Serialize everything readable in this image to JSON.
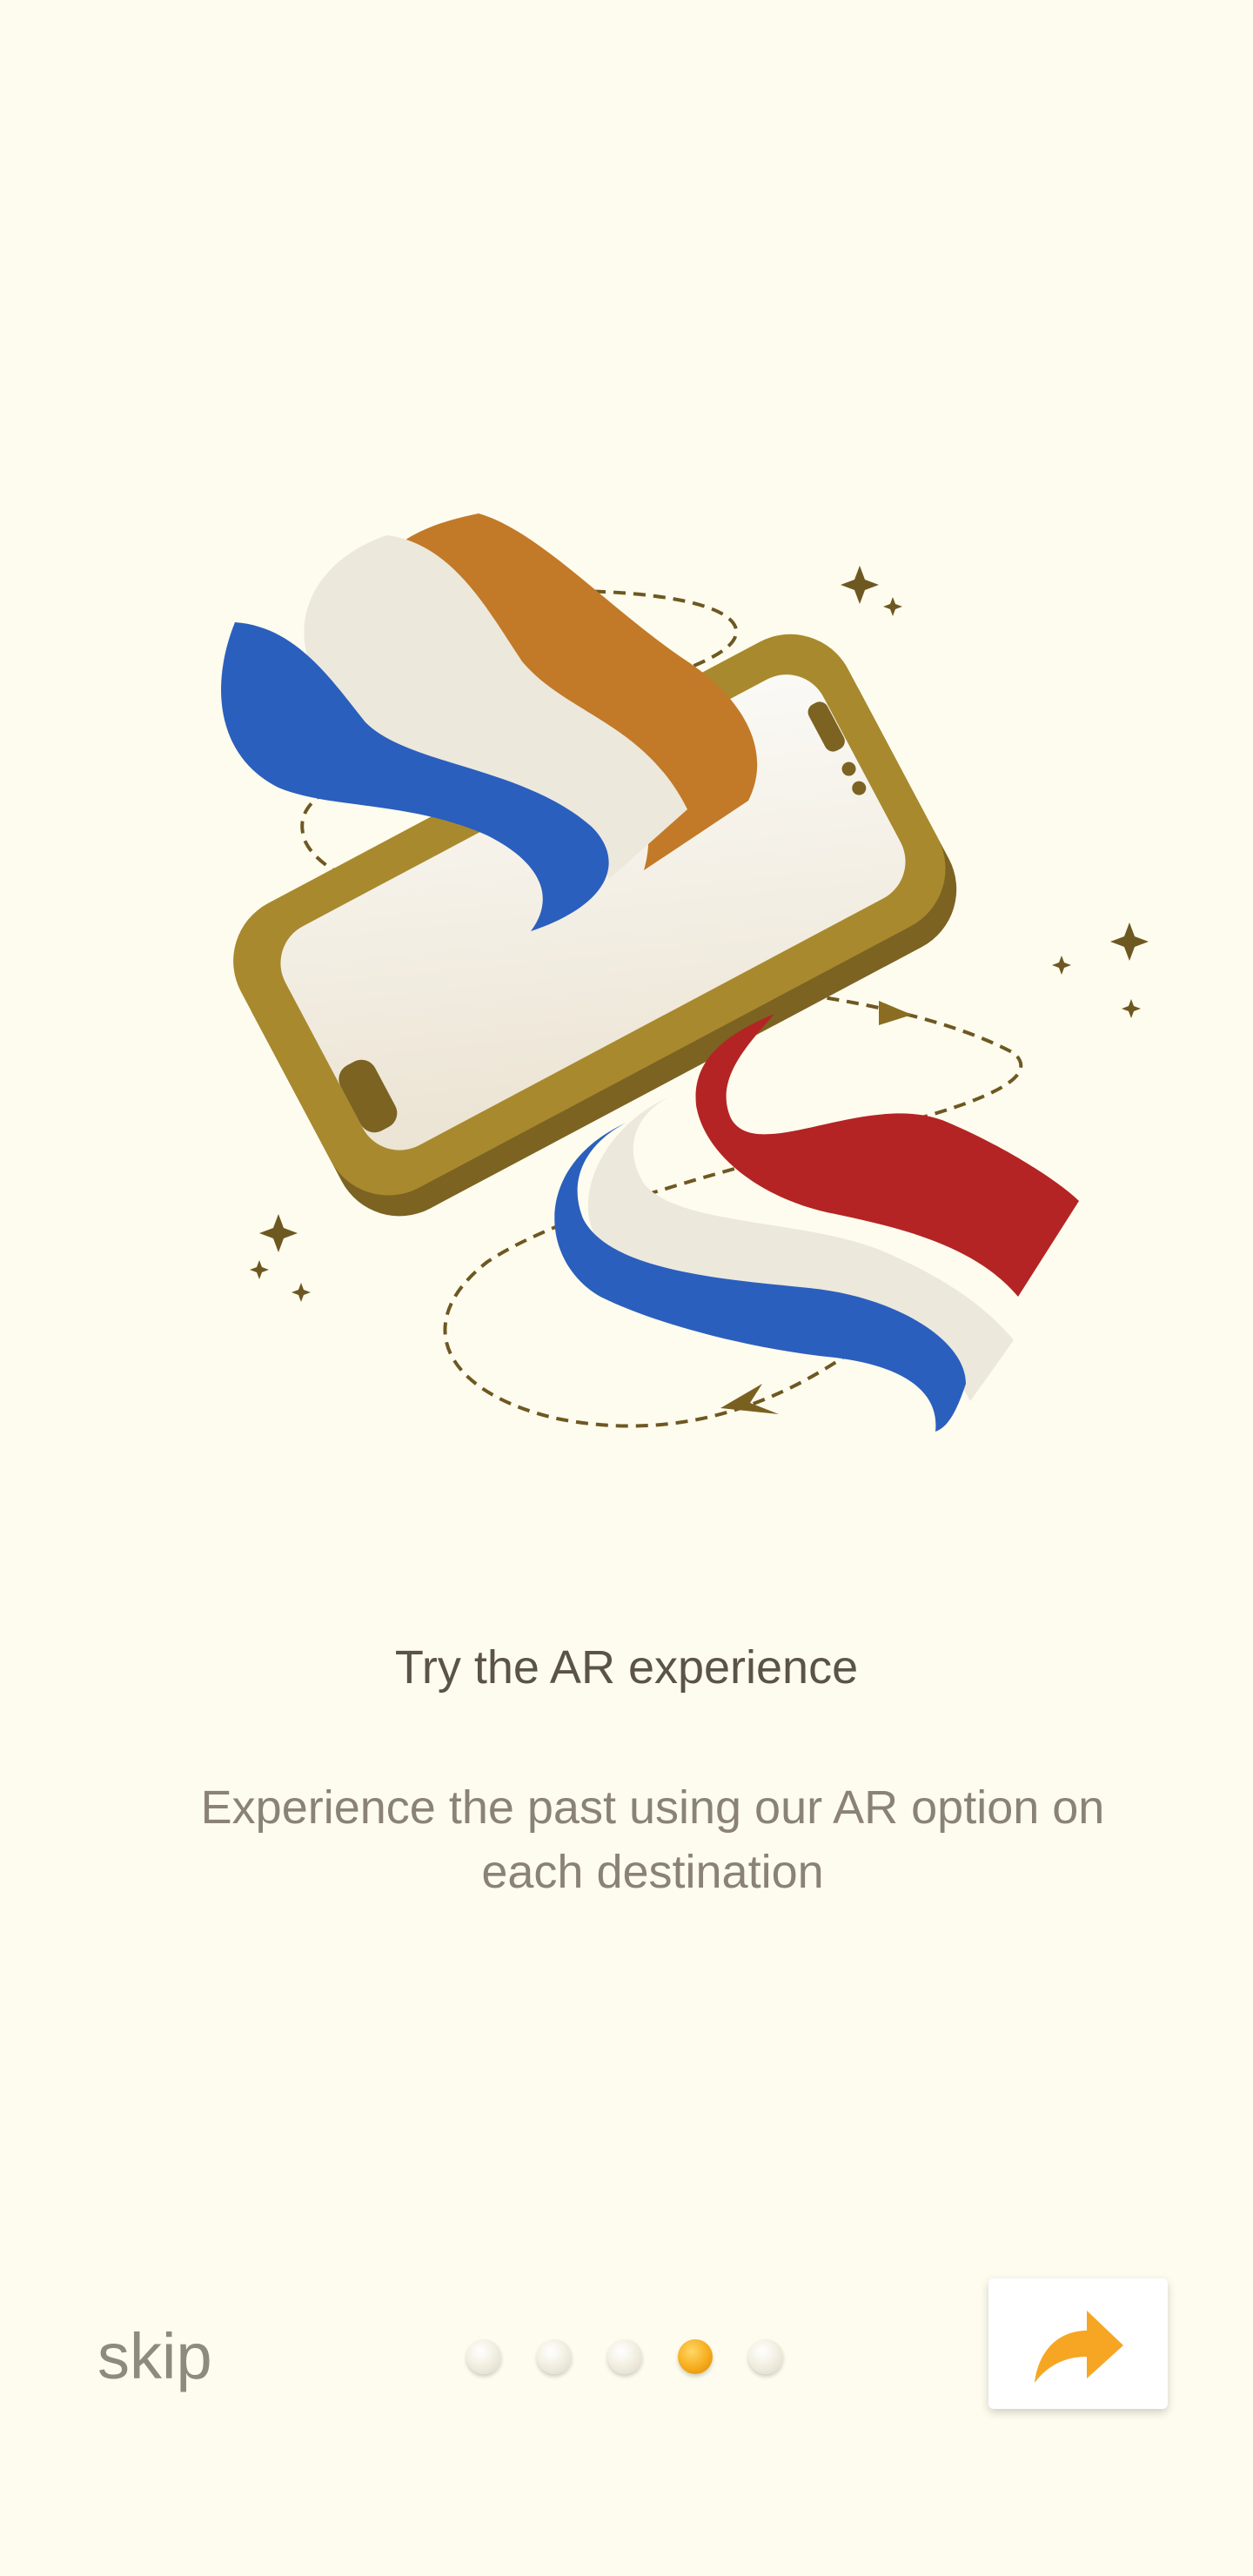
{
  "onboarding": {
    "title": "Try the AR experience",
    "description": "Experience the past using our AR option on each destination",
    "skip_label": "skip",
    "illustration": "phone-with-dutch-flags-ar-illustration",
    "pagination": {
      "total": 5,
      "current": 4
    },
    "next_icon": "forward-arrow-icon"
  },
  "colors": {
    "background": "#fefcee",
    "accent": "#f6a623",
    "phone": "#a8892e",
    "flag_blue": "#2b5fbd",
    "flag_red": "#b42424",
    "flag_orange": "#d0862c"
  }
}
